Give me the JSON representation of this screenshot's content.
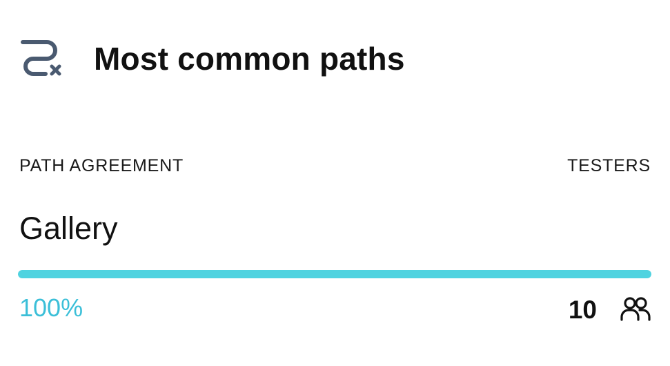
{
  "widget": {
    "title": "Most common paths",
    "icon": "path-icon",
    "icon_color": "#4a5a70",
    "accent_color": "#4fd3e0",
    "percent_color": "#3bbfd8"
  },
  "table": {
    "header_left": "PATH AGREEMENT",
    "header_right": "TESTERS"
  },
  "paths": [
    {
      "name": "Gallery",
      "agreement_label": "100%",
      "agreement_fraction": 1.0,
      "testers": "10",
      "testers_icon": "people-icon"
    }
  ]
}
